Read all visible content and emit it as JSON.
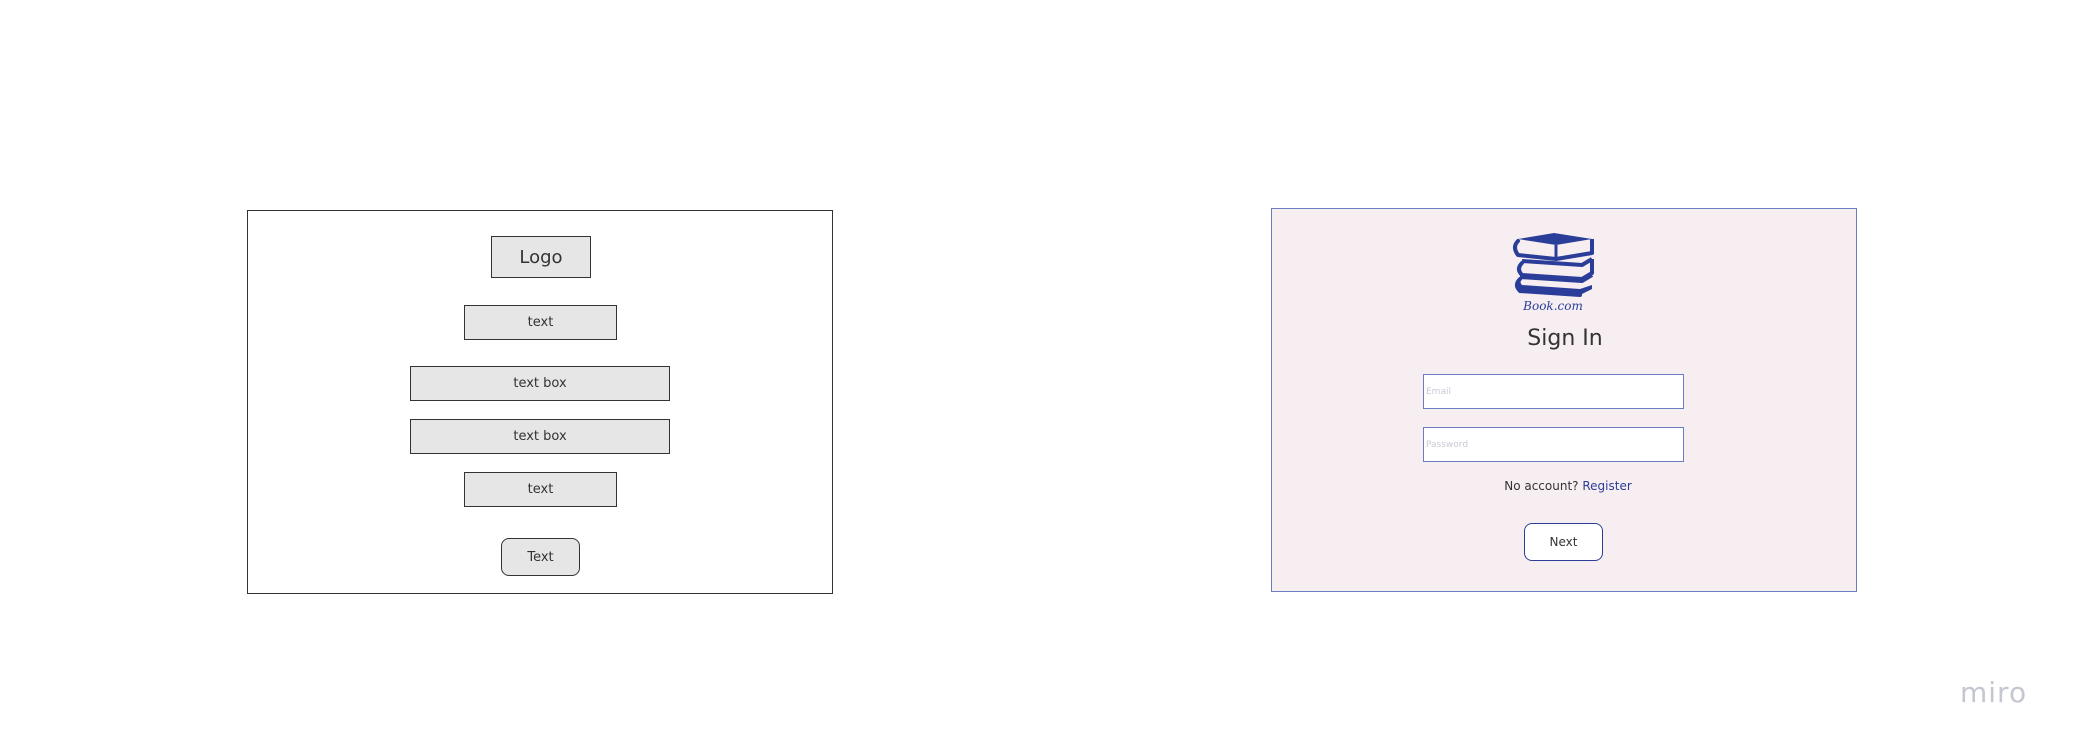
{
  "wireframe": {
    "logo_label": "Logo",
    "text1_label": "text",
    "textbox1_label": "text box",
    "textbox2_label": "text box",
    "text2_label": "text",
    "button_label": "Text"
  },
  "mockup": {
    "brand_name": "Book.com",
    "logo_icon": "books-stack-icon",
    "title": "Sign In",
    "email_placeholder": "Email",
    "password_placeholder": "Password",
    "no_account_text": "No account?",
    "register_link": "Register",
    "next_button": "Next"
  },
  "watermark": {
    "text": "miro"
  },
  "colors": {
    "mockup_background": "#f7eef2",
    "accent_blue": "#2a3d99",
    "frame_border": "#6a7cc4",
    "wireframe_fill": "#e6e6e6"
  }
}
